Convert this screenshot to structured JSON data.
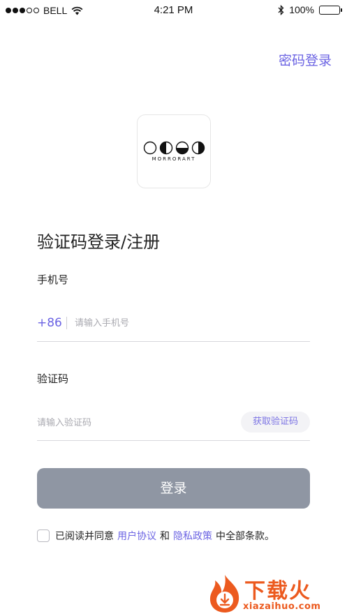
{
  "status_bar": {
    "carrier": "BELL",
    "time": "4:21 PM",
    "battery_text": "100%",
    "battery_level": 1.0
  },
  "header": {
    "password_login_label": "密码登录"
  },
  "logo": {
    "brand_text": "MORRORART"
  },
  "form": {
    "title": "验证码登录/注册",
    "phone_label": "手机号",
    "country_code": "+86",
    "phone_placeholder": "请输入手机号",
    "phone_value": "",
    "code_label": "验证码",
    "code_placeholder": "请输入验证码",
    "code_value": "",
    "get_code_label": "获取验证码",
    "login_label": "登录"
  },
  "agreement": {
    "checked": false,
    "prefix": "已阅读并同意",
    "user_agreement": "用户协议",
    "and": "和",
    "privacy_policy": "隐私政策",
    "suffix": "中全部条款。"
  },
  "watermark": {
    "title": "下载火",
    "subtitle": "xiazaihuo.com"
  },
  "colors": {
    "accent": "#6b63e3",
    "login_button": "#8f96a3",
    "watermark": "#ec5a1f"
  }
}
